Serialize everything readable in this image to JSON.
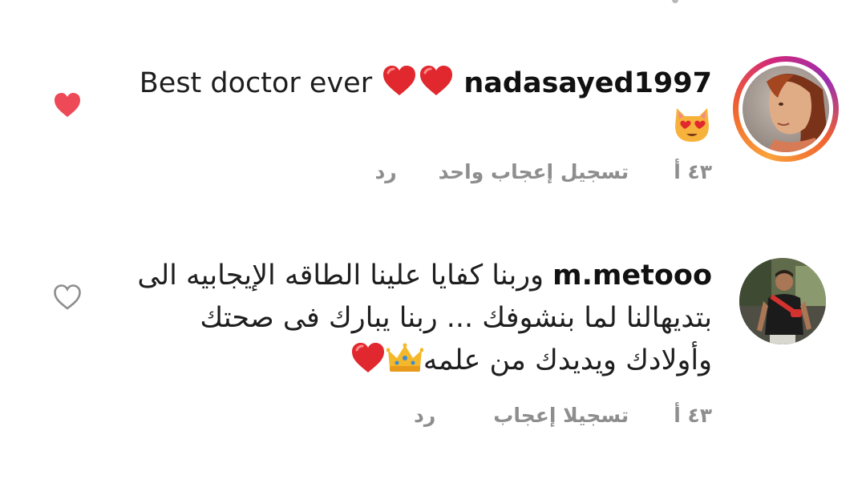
{
  "comments": [
    {
      "username": "nadasayed1997",
      "text": "Best doctor ever",
      "emojis": [
        "red-heart",
        "red-heart",
        "heart-eyes-cat"
      ],
      "time": "٤٣ أ",
      "likes_label": "تسجيل إعجاب واحد",
      "reply_label": "رد",
      "liked": true,
      "has_story_ring": true
    },
    {
      "username": "m.metooo",
      "text": "وربنا كفايا علينا الطاقه الإيجابيه الى بتديهالنا لما بنشوفك ... ربنا يبارك فى صحتك وأولادك ويديدك من علمه",
      "emojis": [
        "crown",
        "red-heart"
      ],
      "time": "٤٣ أ",
      "likes_label": "تسجيلا إعجاب",
      "reply_label": "رد",
      "liked": false,
      "has_story_ring": false
    }
  ],
  "colors": {
    "liked_heart": "#ed4956",
    "meta_text": "#8e8e8e",
    "body_text": "#1e1e1e"
  }
}
